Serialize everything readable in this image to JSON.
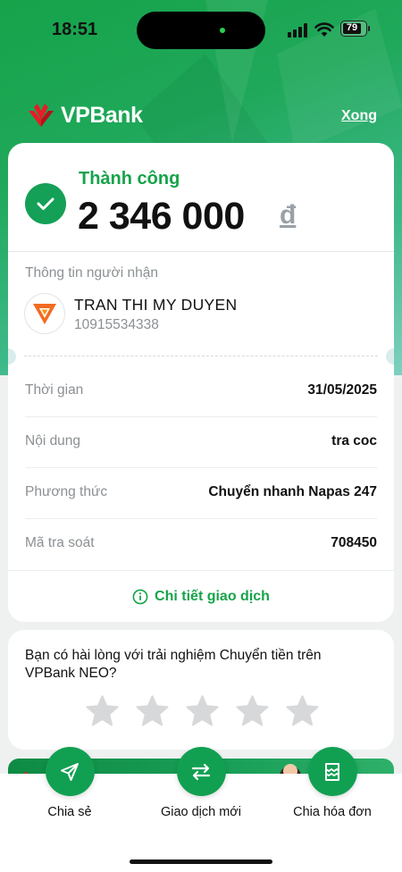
{
  "status_bar": {
    "time": "18:51",
    "battery": "79"
  },
  "header": {
    "brand": "VPBank",
    "done_label": "Xong"
  },
  "result": {
    "status": "Thành công",
    "amount": "2 346 000",
    "currency": "đ"
  },
  "receiver": {
    "label": "Thông tin người nhận",
    "name": "TRAN THI MY DUYEN",
    "account": "10915534338"
  },
  "details": [
    {
      "key": "Thời gian",
      "value": "31/05/2025"
    },
    {
      "key": "Nội dung",
      "value": "tra coc"
    },
    {
      "key": "Phương thức",
      "value": "Chuyển nhanh Napas 247"
    },
    {
      "key": "Mã tra soát",
      "value": "708450"
    }
  ],
  "detail_link": "Chi tiết giao dịch",
  "rating": {
    "question": "Bạn có hài lòng với trải nghiệm Chuyển tiền trên VPBank NEO?",
    "stars": 5,
    "selected": 0
  },
  "actions": [
    {
      "label": "Chia sẻ",
      "icon": "send-icon"
    },
    {
      "label": "Giao dịch mới",
      "icon": "swap-icon"
    },
    {
      "label": "Chia hóa đơn",
      "icon": "split-bill-icon"
    }
  ],
  "colors": {
    "primary": "#16a34a",
    "button": "#11a052"
  }
}
